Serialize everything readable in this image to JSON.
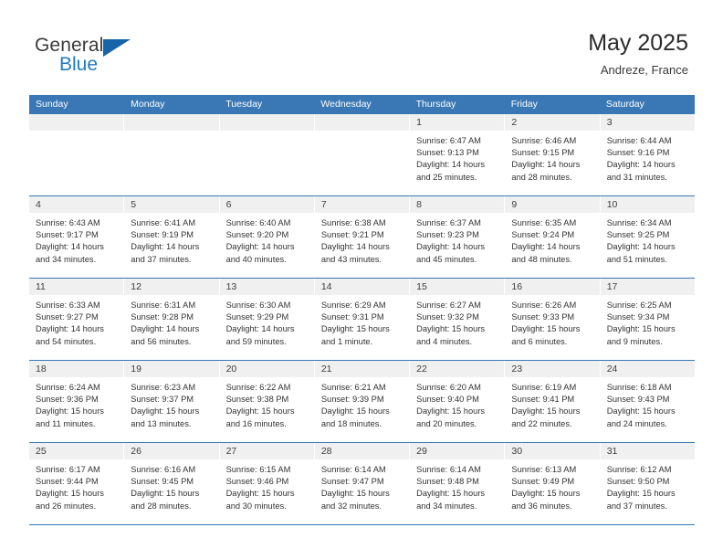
{
  "logo": {
    "word1": "General",
    "word2": "Blue",
    "triangle_color": "#1565a8",
    "blue_color": "#1f7bc1"
  },
  "header": {
    "title": "May 2025",
    "location": "Andreze, France"
  },
  "theme": {
    "header_blue": "#3a78b5",
    "day_band_gray": "#f0f0f0",
    "separator_blue": "#3a78b5"
  },
  "weekdays": [
    "Sunday",
    "Monday",
    "Tuesday",
    "Wednesday",
    "Thursday",
    "Friday",
    "Saturday"
  ],
  "weeks": [
    [
      {
        "day": "",
        "empty": true
      },
      {
        "day": "",
        "empty": true
      },
      {
        "day": "",
        "empty": true
      },
      {
        "day": "",
        "empty": true
      },
      {
        "day": "1",
        "sunrise": "Sunrise: 6:47 AM",
        "sunset": "Sunset: 9:13 PM",
        "daylight": "Daylight: 14 hours and 25 minutes."
      },
      {
        "day": "2",
        "sunrise": "Sunrise: 6:46 AM",
        "sunset": "Sunset: 9:15 PM",
        "daylight": "Daylight: 14 hours and 28 minutes."
      },
      {
        "day": "3",
        "sunrise": "Sunrise: 6:44 AM",
        "sunset": "Sunset: 9:16 PM",
        "daylight": "Daylight: 14 hours and 31 minutes."
      }
    ],
    [
      {
        "day": "4",
        "sunrise": "Sunrise: 6:43 AM",
        "sunset": "Sunset: 9:17 PM",
        "daylight": "Daylight: 14 hours and 34 minutes."
      },
      {
        "day": "5",
        "sunrise": "Sunrise: 6:41 AM",
        "sunset": "Sunset: 9:19 PM",
        "daylight": "Daylight: 14 hours and 37 minutes."
      },
      {
        "day": "6",
        "sunrise": "Sunrise: 6:40 AM",
        "sunset": "Sunset: 9:20 PM",
        "daylight": "Daylight: 14 hours and 40 minutes."
      },
      {
        "day": "7",
        "sunrise": "Sunrise: 6:38 AM",
        "sunset": "Sunset: 9:21 PM",
        "daylight": "Daylight: 14 hours and 43 minutes."
      },
      {
        "day": "8",
        "sunrise": "Sunrise: 6:37 AM",
        "sunset": "Sunset: 9:23 PM",
        "daylight": "Daylight: 14 hours and 45 minutes."
      },
      {
        "day": "9",
        "sunrise": "Sunrise: 6:35 AM",
        "sunset": "Sunset: 9:24 PM",
        "daylight": "Daylight: 14 hours and 48 minutes."
      },
      {
        "day": "10",
        "sunrise": "Sunrise: 6:34 AM",
        "sunset": "Sunset: 9:25 PM",
        "daylight": "Daylight: 14 hours and 51 minutes."
      }
    ],
    [
      {
        "day": "11",
        "sunrise": "Sunrise: 6:33 AM",
        "sunset": "Sunset: 9:27 PM",
        "daylight": "Daylight: 14 hours and 54 minutes."
      },
      {
        "day": "12",
        "sunrise": "Sunrise: 6:31 AM",
        "sunset": "Sunset: 9:28 PM",
        "daylight": "Daylight: 14 hours and 56 minutes."
      },
      {
        "day": "13",
        "sunrise": "Sunrise: 6:30 AM",
        "sunset": "Sunset: 9:29 PM",
        "daylight": "Daylight: 14 hours and 59 minutes."
      },
      {
        "day": "14",
        "sunrise": "Sunrise: 6:29 AM",
        "sunset": "Sunset: 9:31 PM",
        "daylight": "Daylight: 15 hours and 1 minute."
      },
      {
        "day": "15",
        "sunrise": "Sunrise: 6:27 AM",
        "sunset": "Sunset: 9:32 PM",
        "daylight": "Daylight: 15 hours and 4 minutes."
      },
      {
        "day": "16",
        "sunrise": "Sunrise: 6:26 AM",
        "sunset": "Sunset: 9:33 PM",
        "daylight": "Daylight: 15 hours and 6 minutes."
      },
      {
        "day": "17",
        "sunrise": "Sunrise: 6:25 AM",
        "sunset": "Sunset: 9:34 PM",
        "daylight": "Daylight: 15 hours and 9 minutes."
      }
    ],
    [
      {
        "day": "18",
        "sunrise": "Sunrise: 6:24 AM",
        "sunset": "Sunset: 9:36 PM",
        "daylight": "Daylight: 15 hours and 11 minutes."
      },
      {
        "day": "19",
        "sunrise": "Sunrise: 6:23 AM",
        "sunset": "Sunset: 9:37 PM",
        "daylight": "Daylight: 15 hours and 13 minutes."
      },
      {
        "day": "20",
        "sunrise": "Sunrise: 6:22 AM",
        "sunset": "Sunset: 9:38 PM",
        "daylight": "Daylight: 15 hours and 16 minutes."
      },
      {
        "day": "21",
        "sunrise": "Sunrise: 6:21 AM",
        "sunset": "Sunset: 9:39 PM",
        "daylight": "Daylight: 15 hours and 18 minutes."
      },
      {
        "day": "22",
        "sunrise": "Sunrise: 6:20 AM",
        "sunset": "Sunset: 9:40 PM",
        "daylight": "Daylight: 15 hours and 20 minutes."
      },
      {
        "day": "23",
        "sunrise": "Sunrise: 6:19 AM",
        "sunset": "Sunset: 9:41 PM",
        "daylight": "Daylight: 15 hours and 22 minutes."
      },
      {
        "day": "24",
        "sunrise": "Sunrise: 6:18 AM",
        "sunset": "Sunset: 9:43 PM",
        "daylight": "Daylight: 15 hours and 24 minutes."
      }
    ],
    [
      {
        "day": "25",
        "sunrise": "Sunrise: 6:17 AM",
        "sunset": "Sunset: 9:44 PM",
        "daylight": "Daylight: 15 hours and 26 minutes."
      },
      {
        "day": "26",
        "sunrise": "Sunrise: 6:16 AM",
        "sunset": "Sunset: 9:45 PM",
        "daylight": "Daylight: 15 hours and 28 minutes."
      },
      {
        "day": "27",
        "sunrise": "Sunrise: 6:15 AM",
        "sunset": "Sunset: 9:46 PM",
        "daylight": "Daylight: 15 hours and 30 minutes."
      },
      {
        "day": "28",
        "sunrise": "Sunrise: 6:14 AM",
        "sunset": "Sunset: 9:47 PM",
        "daylight": "Daylight: 15 hours and 32 minutes."
      },
      {
        "day": "29",
        "sunrise": "Sunrise: 6:14 AM",
        "sunset": "Sunset: 9:48 PM",
        "daylight": "Daylight: 15 hours and 34 minutes."
      },
      {
        "day": "30",
        "sunrise": "Sunrise: 6:13 AM",
        "sunset": "Sunset: 9:49 PM",
        "daylight": "Daylight: 15 hours and 36 minutes."
      },
      {
        "day": "31",
        "sunrise": "Sunrise: 6:12 AM",
        "sunset": "Sunset: 9:50 PM",
        "daylight": "Daylight: 15 hours and 37 minutes."
      }
    ]
  ]
}
